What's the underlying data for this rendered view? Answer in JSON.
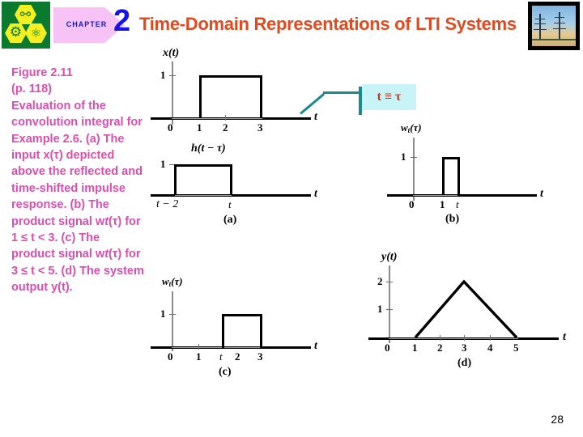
{
  "header": {
    "chapter_word": "CHAPTER",
    "chapter_number": "2",
    "title": "Time-Domain Representations of LTI Systems",
    "logo_icons": [
      "dna-helix",
      "gear",
      "atom"
    ],
    "photo_alt": "electricity-pylons"
  },
  "caption": {
    "line1": "Figure 2.11",
    "line2": "(p. 118)",
    "line3": "Evaluation of the convolution integral for Example 2.6. (a) The input x(τ) depicted above the reflected and time-shifted impulse response.  (b) The product signal w",
    "sub_b": "t",
    "line4": "(τ) for 1 ≤ t < 3.  (c) The product signal w",
    "sub_c": "t",
    "line5": "(τ) for 3 ≤ t < 5. (d) The system output y(t)."
  },
  "callout": {
    "text": "t ≡ τ",
    "box_color": "#c9f4f7",
    "text_color": "#c0392b",
    "connector_color": "#1b8a8a"
  },
  "page_number": "28",
  "colors": {
    "title": "#e04a20",
    "chapter_number": "#1414e6",
    "caption": "#d94fae",
    "arrow": "#f7c3f7",
    "logo_bg": "#0a7a2f",
    "logo_hex": "#f2ef22"
  },
  "chart_data": [
    {
      "id": "a-top",
      "type": "line",
      "title": "x(t)",
      "ylabel": "x(t)",
      "xlabel": "t",
      "xticks": [
        "0",
        "1",
        "2",
        "3"
      ],
      "yticks": [
        "1"
      ],
      "xlim": [
        -0.6,
        4.6
      ],
      "ylim": [
        0,
        1.35
      ],
      "x": [
        0,
        1,
        1,
        3,
        3,
        4.4
      ],
      "y": [
        0,
        0,
        1,
        1,
        0,
        0
      ],
      "description": "Rectangular pulse of amplitude 1 from t=1 to t=3"
    },
    {
      "id": "a-bottom",
      "type": "line",
      "title": "h(t − τ)",
      "ylabel": "",
      "xlabel": "t",
      "xticks": [
        "t − 2",
        "t"
      ],
      "yticks": [
        "1"
      ],
      "xlim": [
        -1.4,
        4.6
      ],
      "ylim": [
        0,
        1.35
      ],
      "x": [
        -1.2,
        -0.6,
        -0.6,
        1.0,
        1.0,
        4.4
      ],
      "y": [
        0,
        0,
        1,
        1,
        0,
        0
      ],
      "panel_label": "(a)",
      "description": "Reflected and time-shifted impulse response, amplitude 1 between t-2 and t"
    },
    {
      "id": "b",
      "type": "line",
      "title": "w",
      "title_sub": "t",
      "title_rest": "(τ)",
      "ylabel": "w_t(τ)",
      "xlabel": "t",
      "xticks": [
        "0",
        "1",
        "t"
      ],
      "yticks": [
        "1"
      ],
      "xlim": [
        -0.9,
        4.4
      ],
      "ylim": [
        0,
        1.35
      ],
      "x": [
        -0.8,
        1.0,
        1.0,
        1.6,
        1.6,
        4.2
      ],
      "y": [
        0,
        0,
        1,
        1,
        0,
        0
      ],
      "panel_label": "(b)",
      "description": "Product signal, amplitude 1 from 1 to t, for 1 ≤ t < 3"
    },
    {
      "id": "c",
      "type": "line",
      "title": "w",
      "title_sub": "t",
      "title_rest": "(τ)",
      "ylabel": "w_t(τ)",
      "xlabel": "t",
      "xticks": [
        "0",
        "1",
        "t",
        "2",
        "3"
      ],
      "yticks": [
        "1"
      ],
      "xlim": [
        -0.7,
        4.4
      ],
      "ylim": [
        0,
        1.35
      ],
      "x": [
        -0.6,
        1.55,
        1.55,
        3.0,
        3.0,
        4.2
      ],
      "y": [
        0,
        0,
        1,
        1,
        0,
        0
      ],
      "panel_label": "(c)",
      "description": "Product signal, amplitude 1 from t to 3, for 3 ≤ t < 5"
    },
    {
      "id": "d",
      "type": "line",
      "title": "y(t)",
      "ylabel": "y(t)",
      "xlabel": "t",
      "xticks": [
        "0",
        "1",
        "2",
        "3",
        "4",
        "5"
      ],
      "yticks": [
        "1",
        "2"
      ],
      "xlim": [
        -0.8,
        6.4
      ],
      "ylim": [
        0,
        2.4
      ],
      "x": [
        -0.7,
        1,
        3,
        5,
        6.2
      ],
      "y": [
        0,
        0,
        2,
        0,
        0
      ],
      "description": "System output: triangular waveform peaking at 2 when t=3, zero outside 1 < t < 5"
    }
  ]
}
